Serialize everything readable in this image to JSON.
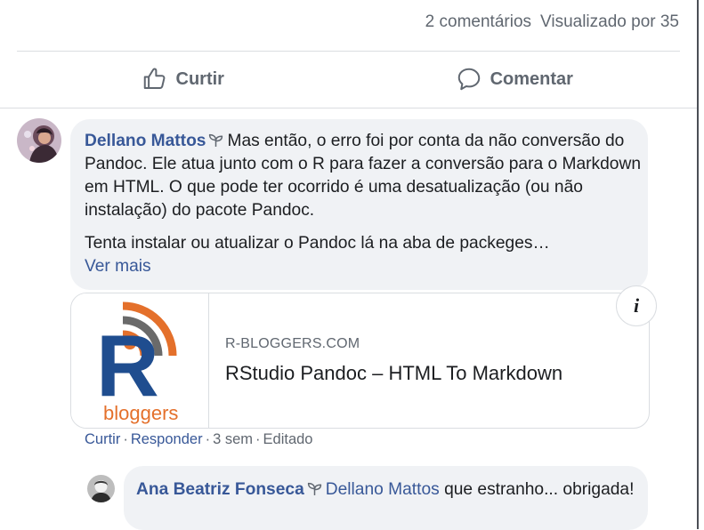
{
  "stats": {
    "comments": "2 comentários",
    "views": "Visualizado por 35"
  },
  "actions": {
    "like": "Curtir",
    "comment": "Comentar"
  },
  "comment1": {
    "author": "Dellano Mattos",
    "paragraph1": "Mas então, o erro foi por conta da não conversão do Pandoc. Ele atua junto com o R para fazer a conversão para o Markdown em HTML. O que pode ter ocorrido é uma desatualização (ou não instalação) do pacote Pandoc.",
    "paragraph2": "Tenta instalar ou atualizar o Pandoc lá na aba de packeges…",
    "see_more": "Ver mais",
    "link": {
      "logo_text": "bloggers",
      "logo_letter": "R",
      "domain": "R-BLOGGERS.COM",
      "title": "RStudio Pandoc – HTML To Markdown",
      "info_icon": "i"
    },
    "meta": {
      "like": "Curtir",
      "reply": "Responder",
      "time": "3 sem",
      "edited": "Editado",
      "separator": "·"
    }
  },
  "comment2": {
    "author": "Ana Beatriz Fonseca",
    "mention": "Dellano Mattos",
    "text": "que estranho... obrigada!"
  },
  "colors": {
    "link_blue": "#385898",
    "bubble": "#f0f2f5",
    "secondary_text": "#606770",
    "logo_orange": "#e4702b",
    "logo_navy": "#1f4d8f"
  }
}
